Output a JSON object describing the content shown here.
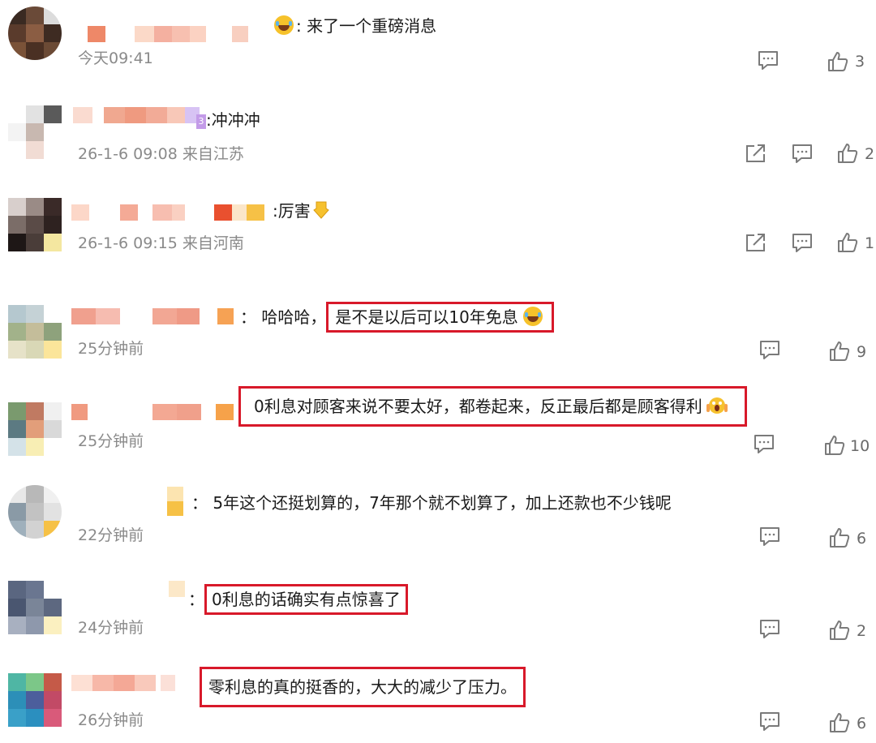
{
  "comments": [
    {
      "content": ": 来了一个重磅消息",
      "emoji_before": "laughing-tears",
      "time": "今天09:41",
      "has_share": false,
      "likes": "3"
    },
    {
      "content": ":冲冲冲",
      "level_badge": "3",
      "time": "26-1-6 09:08 来自江苏",
      "has_share": true,
      "likes": "2"
    },
    {
      "content": ":厉害",
      "emoji_after": "pointing-down-hand",
      "time": "26-1-6 09:15 来自河南",
      "has_share": true,
      "likes": "1"
    },
    {
      "content_prefix": "： 哈哈哈，",
      "content_highlight": "是不是以后可以10年免息",
      "emoji_after": "laughing-tears",
      "time": "25分钟前",
      "likes": "9"
    },
    {
      "content_highlight": "0利息对顾客来说不要太好，都卷起来，反正最后都是顾客得利",
      "emoji_after": "screaming-face",
      "time": "25分钟前",
      "likes": "10"
    },
    {
      "content": "： 5年这个还挺划算的，7年那个就不划算了，加上还款也不少钱呢",
      "time": "22分钟前",
      "likes": "6"
    },
    {
      "content_prefix": "：",
      "content_highlight": "0利息的话确实有点惊喜了",
      "time": "24分钟前",
      "likes": "2"
    },
    {
      "content_highlight": "零利息的真的挺香的，大大的减少了压力。",
      "time": "26分钟前",
      "likes": "6"
    }
  ],
  "icons": {
    "comment": "comment-bubble-icon",
    "like": "thumbs-up-icon",
    "share": "share-arrow-icon"
  },
  "colors": {
    "highlight_border": "#d8192a",
    "meta_text": "#8a8a8a",
    "icon_gray": "#7a7a7a"
  }
}
